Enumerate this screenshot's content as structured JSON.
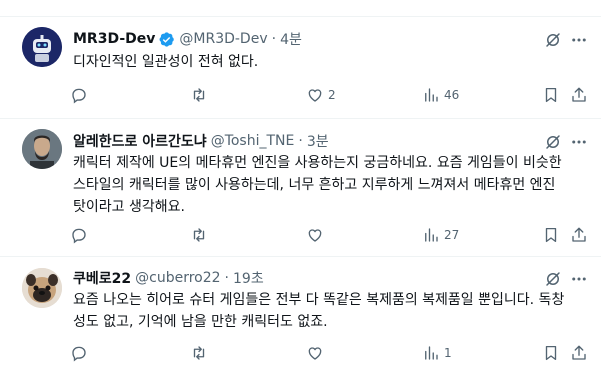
{
  "tweets": [
    {
      "name": "MR3D-Dev",
      "verified": true,
      "handle": "@MR3D-Dev",
      "time": "4분",
      "text": "디자인적인 일관성이 전혀 없다.",
      "replies": "",
      "retweets": "",
      "likes": "2",
      "views": "46",
      "avatar_icon": "robot-avatar"
    },
    {
      "name": "알레한드로 아르간도냐",
      "verified": false,
      "handle": "@Toshi_TNE",
      "time": "3분",
      "text": "캐릭터 제작에 UE의 메타휴먼 엔진을 사용하는지 궁금하네요. 요즘 게임들이 비슷한\n스타일의 캐릭터를 많이 사용하는데, 너무 흔하고 지루하게 느껴져서 메타휴먼 엔진\n탓이라고 생각해요.",
      "replies": "",
      "retweets": "",
      "likes": "",
      "views": "27",
      "avatar_icon": "person-photo-avatar"
    },
    {
      "name": "쿠베로22",
      "verified": false,
      "handle": "@cuberro22",
      "time": "19초",
      "text": "요즘 나오는 히어로 슈터 게임들은 전부 다 똑같은 복제품의 복제품일 뿐입니다. 독창\n성도 없고, 기억에 남을 만한 캐릭터도 없죠.",
      "replies": "",
      "retweets": "",
      "likes": "",
      "views": "1",
      "avatar_icon": "pug-dog-avatar"
    }
  ],
  "colors": {
    "text": "#0f1419",
    "secondary": "#536471",
    "verified": "#1d9bf0",
    "divider": "#eff3f4"
  }
}
